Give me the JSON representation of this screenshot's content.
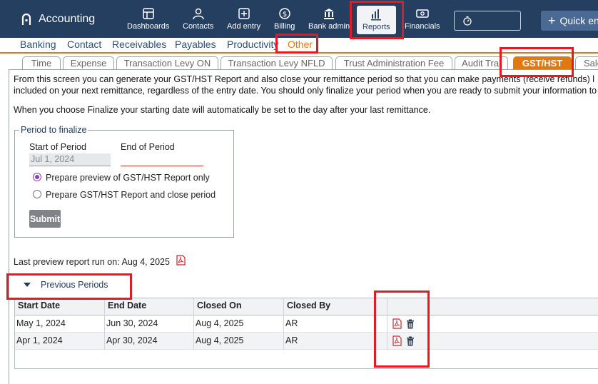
{
  "app": {
    "title": "Accounting",
    "nav": [
      {
        "label": "Dashboards",
        "icon": "dashboards-icon"
      },
      {
        "label": "Contacts",
        "icon": "contacts-icon"
      },
      {
        "label": "Add entry",
        "icon": "add-entry-icon"
      },
      {
        "label": "Billing",
        "icon": "billing-icon"
      },
      {
        "label": "Bank admin",
        "icon": "bank-icon"
      },
      {
        "label": "Reports",
        "icon": "reports-icon",
        "active": true
      },
      {
        "label": "Financials",
        "icon": "financials-icon"
      }
    ],
    "quick_entry_label": "Quick en"
  },
  "subnav": {
    "items": [
      "Banking",
      "Contact",
      "Receivables",
      "Payables",
      "Productivity",
      "Other"
    ],
    "active": "Other"
  },
  "tabs": {
    "items": [
      "Time",
      "Expense",
      "Transaction Levy ON",
      "Transaction Levy NFLD",
      "Trust Administration Fee",
      "Audit Trai",
      "GST/HST",
      "Sale"
    ],
    "active": "GST/HST"
  },
  "content": {
    "intro_line1": "From this screen you can generate your GST/HST Report and also close your remittance period so that you can make payments (receive refunds) l",
    "intro_line2": "included on your next remittance, regardless of the entry date. You should only finalize your period when you are ready to submit your information to",
    "intro_line3": "When you choose Finalize your starting date will automatically be set to the day after your last remittance.",
    "period": {
      "legend": "Period to finalize",
      "start_label": "Start of Period",
      "end_label": "End of Period",
      "start_value": "Jul 1, 2024",
      "end_value": "",
      "option_preview": "Prepare preview of GST/HST Report only",
      "option_close": "Prepare GST/HST Report and close period",
      "selected": "preview",
      "submit_label": "Submit"
    },
    "last_preview_label": "Last preview report run on:",
    "last_preview_date": "Aug 4, 2025",
    "previous_periods_label": "Previous Periods"
  },
  "table": {
    "columns": [
      "Start Date",
      "End Date",
      "Closed On",
      "Closed By"
    ],
    "rows": [
      {
        "start": "May 1, 2024",
        "end": "Jun 30, 2024",
        "closed_on": "Aug 4, 2025",
        "closed_by": "AR"
      },
      {
        "start": "Apr 1, 2024",
        "end": "Apr 30, 2024",
        "closed_on": "Aug 4, 2025",
        "closed_by": "AR"
      }
    ]
  },
  "colors": {
    "topbar": "#243f60",
    "accent_orange": "#e07a10",
    "highlight_red": "#e01b24",
    "link_blue": "#2a4f7a"
  }
}
